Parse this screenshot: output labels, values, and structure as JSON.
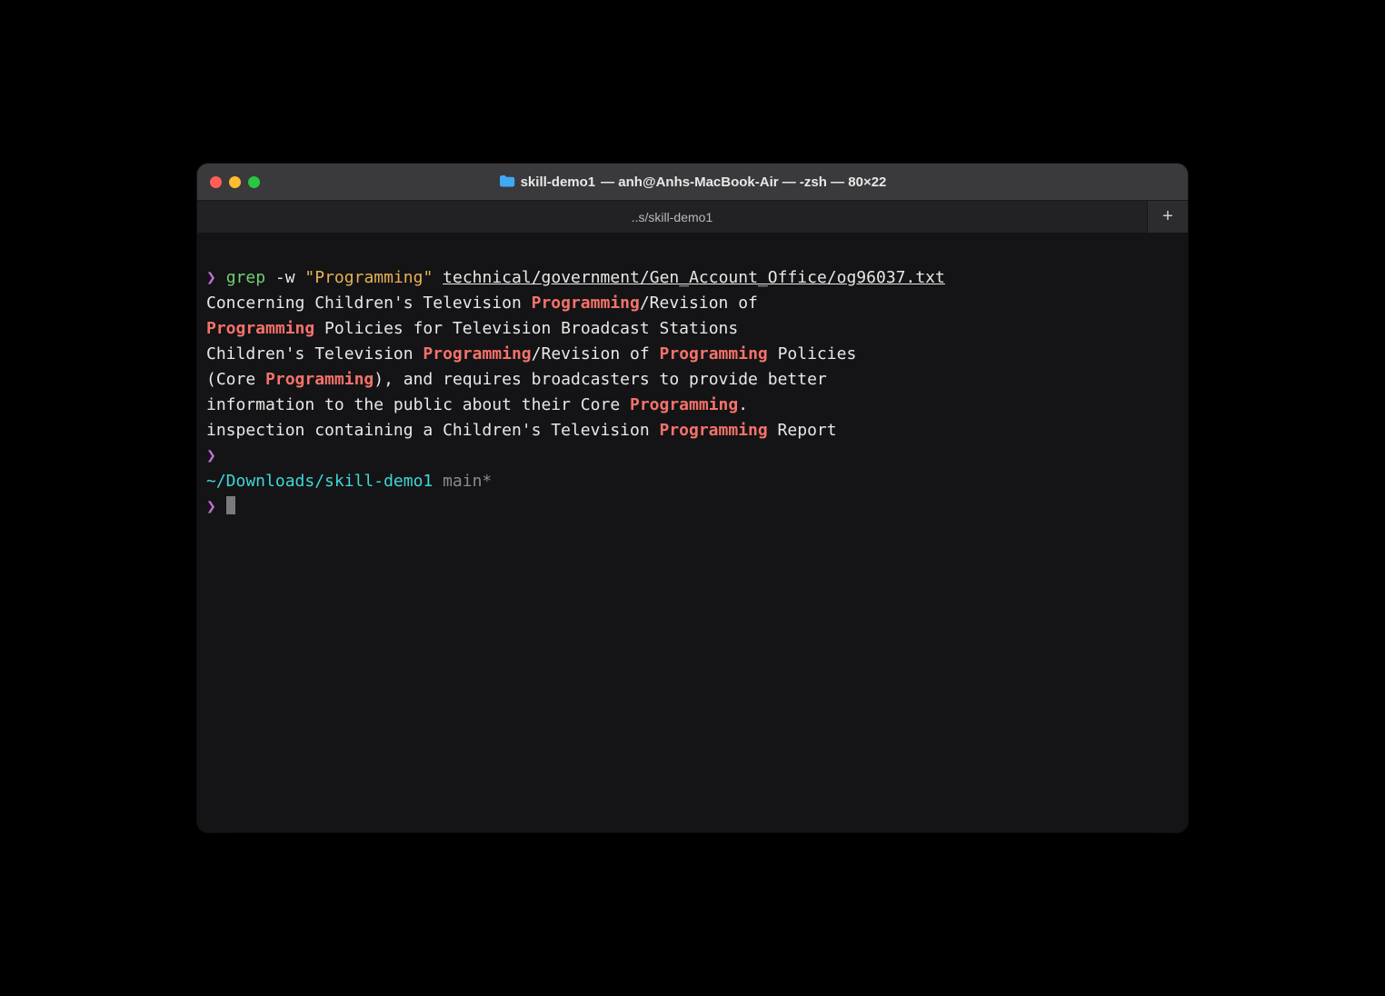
{
  "window": {
    "title_folder": "skill-demo1",
    "title_rest": " — anh@Anhs-MacBook-Air — -zsh — 80×22",
    "tab_label": "..s/skill-demo1",
    "new_tab_glyph": "+"
  },
  "colors": {
    "highlight": "#f5726a",
    "prompt": "#c76dd7",
    "command": "#6fd26f",
    "string": "#e7b255",
    "cwd": "#3fd7d7"
  },
  "cmd": {
    "prompt": "❯",
    "name": "grep",
    "flag": "-w",
    "arg_str": "\"Programming\"",
    "path": "technical/government/Gen_Account_Office/og96037.txt"
  },
  "out": {
    "l1_a": "Concerning Children's Television ",
    "l1_hl": "Programming",
    "l1_b": "/Revision of",
    "l2_hl": "Programming",
    "l2_a": " Policies for Television Broadcast Stations",
    "l3_a": "Children's Television ",
    "l3_hl1": "Programming",
    "l3_b": "/Revision of ",
    "l3_hl2": "Programming",
    "l3_c": " Policies",
    "l4_a": "(Core ",
    "l4_hl": "Programming",
    "l4_b": "), and requires broadcasters to provide better",
    "l5_a": "information to the public about their Core ",
    "l5_hl": "Programming",
    "l5_b": ".",
    "l6_a": "inspection containing a Children's Television ",
    "l6_hl": "Programming",
    "l6_b": " Report"
  },
  "prompt2": {
    "symbol": "❯",
    "cwd": "~/Downloads/skill-demo1",
    "branch": " main*",
    "symbol2": "❯"
  }
}
